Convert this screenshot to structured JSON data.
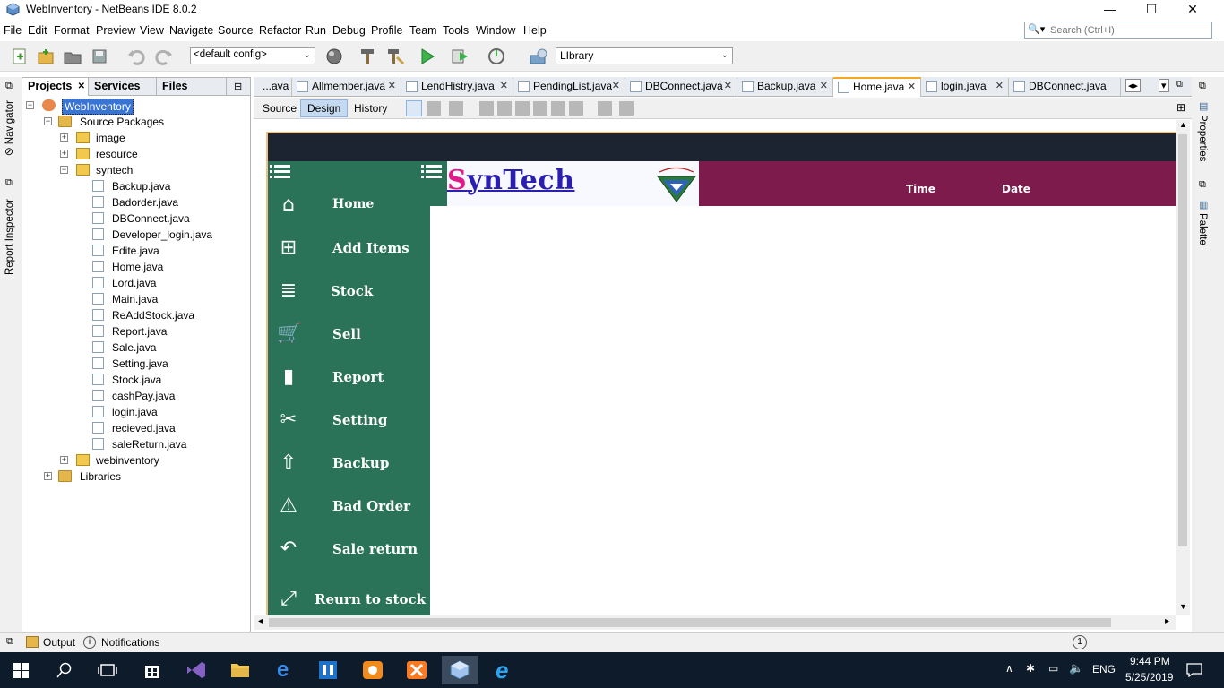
{
  "window": {
    "title": "WebInventory - NetBeans IDE 8.0.2",
    "minimize_glyph": "—",
    "maximize_glyph": "☐",
    "close_glyph": "✕"
  },
  "menu": [
    "File",
    "Edit",
    "Format",
    "Preview",
    "View",
    "Navigate",
    "Source",
    "Refactor",
    "Run",
    "Debug",
    "Profile",
    "Team",
    "Tools",
    "Window",
    "Help"
  ],
  "search": {
    "placeholder": "Search (Ctrl+I)"
  },
  "toolbar": {
    "config_value": "<default config>",
    "library_value": "LIbrary"
  },
  "left_strip": {
    "navigator": "Navigator",
    "report_inspector": "Report Inspector"
  },
  "right_strip": {
    "properties": "Properties",
    "palette": "Palette"
  },
  "project_panel": {
    "tabs": [
      "Projects",
      "Services",
      "Files"
    ],
    "root": "WebInventory",
    "source_packages": "Source Packages",
    "packages": [
      "image",
      "resource",
      "syntech"
    ],
    "files": [
      "Backup.java",
      "Badorder.java",
      "DBConnect.java",
      "Developer_login.java",
      "Edite.java",
      "Home.java",
      "Lord.java",
      "Main.java",
      "ReAddStock.java",
      "Report.java",
      "Sale.java",
      "Setting.java",
      "Stock.java",
      "cashPay.java",
      "login.java",
      "recieved.java",
      "saleReturn.java"
    ],
    "webinventory_pkg": "webinventory",
    "libraries": "Libraries"
  },
  "editor_tabs": [
    "...ava",
    "Allmember.java",
    "LendHistry.java",
    "PendingList.java",
    "DBConnect.java",
    "Backup.java",
    "Home.java",
    "login.java",
    "DBConnect.java"
  ],
  "design_toolbar": {
    "source": "Source",
    "design": "Design",
    "history": "History"
  },
  "form": {
    "brand_s": "S",
    "brand_rest": "ynTech",
    "logo_text": "SynTech",
    "time_label": "Time",
    "date_label": "Date",
    "nav": [
      {
        "label": "Home",
        "icon": "⌂"
      },
      {
        "label": "Add Items",
        "icon": "⊞"
      },
      {
        "label": "Stock",
        "icon": "≣"
      },
      {
        "label": "Sell",
        "icon": "🛒"
      },
      {
        "label": "Report",
        "icon": "▮"
      },
      {
        "label": "Setting",
        "icon": "✂"
      },
      {
        "label": "Backup",
        "icon": "⇧"
      },
      {
        "label": "Bad Order",
        "icon": "⚠"
      },
      {
        "label": "Sale return",
        "icon": "↶"
      },
      {
        "label": "Reurn to stock",
        "icon": "⤢"
      }
    ]
  },
  "status": {
    "output": "Output",
    "notifications": "Notifications",
    "badge": "1"
  },
  "taskbar": {
    "time": "9:44 PM",
    "date": "5/25/2019",
    "lang": "ENG"
  },
  "colors": {
    "nav_green": "#2a7358",
    "header_maroon": "#7d1b4c",
    "frame_top": "#1b2430",
    "brand_blue": "#2a1fb0",
    "brand_pink": "#e21b8a"
  }
}
